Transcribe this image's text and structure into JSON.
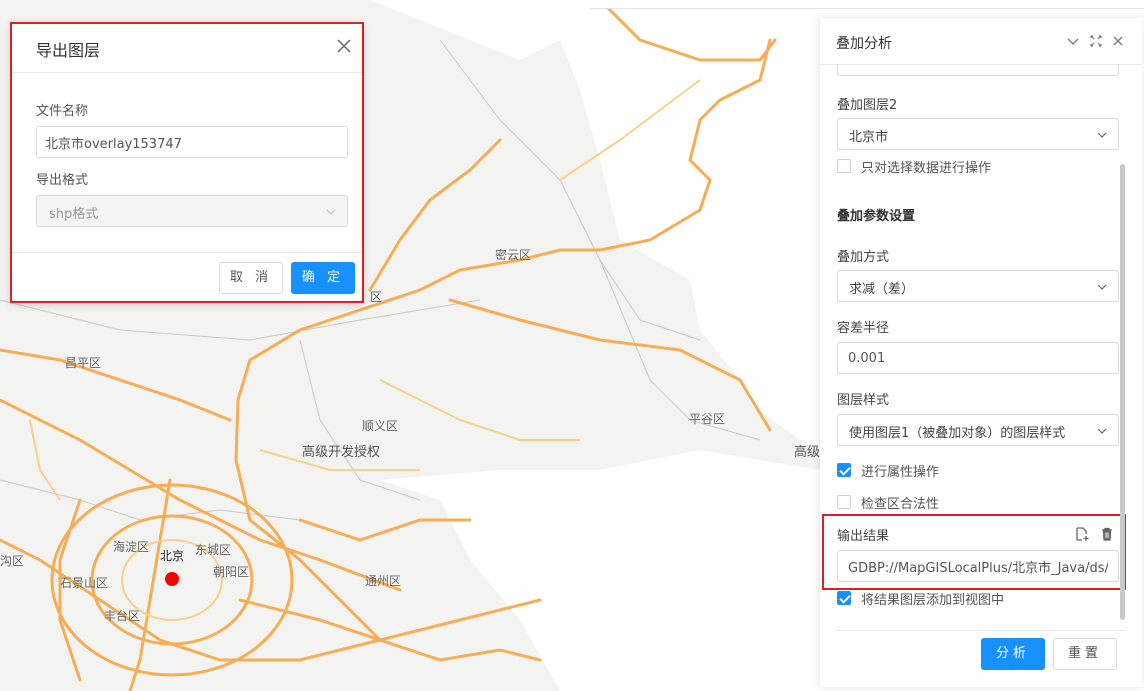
{
  "map": {
    "labels": {
      "miyun": "密云区",
      "huairou_partial": "区",
      "changping": "昌平区",
      "shunyi": "顺义区",
      "pinggu": "平谷区",
      "gaoji": "高级开发授权",
      "gaoji_partial": "高级",
      "haidian": "海淀区",
      "beijing": "北京",
      "dongcheng": "东城区",
      "chaoyang": "朝阳区",
      "shijingshan": "石景山区",
      "fengtai": "丰台区",
      "tongzhou": "通州区",
      "mentougou_partial": "沟区"
    },
    "colors": {
      "road": "#f6ad55",
      "road_minor": "#f9d08a",
      "land": "#f3f3f1",
      "water": "#ffffff",
      "marker": "#ff0000"
    }
  },
  "export_dialog": {
    "title": "导出图层",
    "filename_label": "文件名称",
    "filename_value": "北京市overlay153747",
    "format_label": "导出格式",
    "format_value": "shp格式",
    "cancel_label": "取 消",
    "confirm_label": "确 定"
  },
  "panel": {
    "title": "叠加分析",
    "layer2_label": "叠加图层2",
    "layer2_value": "北京市",
    "selected_only_label": "只对选择数据进行操作",
    "selected_only_checked": false,
    "params_title": "叠加参数设置",
    "method_label": "叠加方式",
    "method_value": "求减（差）",
    "tolerance_label": "容差半径",
    "tolerance_value": "0.001",
    "style_label": "图层样式",
    "style_value": "使用图层1（被叠加对象）的图层样式",
    "attr_op_label": "进行属性操作",
    "attr_op_checked": true,
    "check_valid_label": "检查区合法性",
    "check_valid_checked": false,
    "output_label": "输出结果",
    "output_value": "GDBP://MapGISLocalPlus/北京市_Java/ds/",
    "add_to_view_label": "将结果图层添加到视图中",
    "add_to_view_checked": true,
    "analyze_label": "分析",
    "reset_label": "重置"
  },
  "colors": {
    "primary": "#1890ff",
    "highlight_border": "#e02020"
  }
}
